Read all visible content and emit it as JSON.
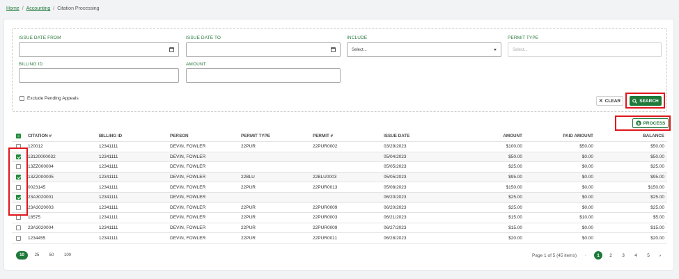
{
  "breadcrumb": {
    "home": "Home",
    "accounting": "Accounting",
    "current": "Citation Processing",
    "sep": "/"
  },
  "filters": {
    "issue_date_from": {
      "label": "ISSUE DATE FROM",
      "value": ""
    },
    "issue_date_to": {
      "label": "ISSUE DATE TO",
      "value": ""
    },
    "include": {
      "label": "INCLUDE",
      "value": "Select..."
    },
    "permit_type": {
      "label": "PERMIT TYPE",
      "placeholder": "Select..."
    },
    "billing_id": {
      "label": "BILLING ID",
      "value": ""
    },
    "amount": {
      "label": "AMOUNT",
      "value": ""
    },
    "exclude_pending_appeals": {
      "label": "Exclude Pending Appeals",
      "checked": false
    }
  },
  "buttons": {
    "clear": "CLEAR",
    "search": "SEARCH",
    "process": "PROCESS"
  },
  "table": {
    "columns": [
      "CITATION #",
      "BILLING ID",
      "PERSON",
      "PERMIT TYPE",
      "PERMIT #",
      "ISSUE DATE",
      "AMOUNT",
      "PAID AMOUNT",
      "BALANCE"
    ],
    "rows": [
      {
        "checked": false,
        "citation": "120012",
        "billing": "12341111",
        "person": "DEVIN, FOWLER",
        "ptype": "22PUR",
        "permit": "22PUR0002",
        "date": "03/29/2023",
        "amount": "$100.00",
        "paid": "$50.00",
        "balance": "$50.00"
      },
      {
        "checked": true,
        "citation": "13120000032",
        "billing": "12341111",
        "person": "DEVIN, FOWLER",
        "ptype": "",
        "permit": "",
        "date": "05/04/2023",
        "amount": "$50.00",
        "paid": "$0.00",
        "balance": "$50.00"
      },
      {
        "checked": false,
        "citation": "13ZZ000004",
        "billing": "12341111",
        "person": "DEVIN, FOWLER",
        "ptype": "",
        "permit": "",
        "date": "05/05/2023",
        "amount": "$25.00",
        "paid": "$0.00",
        "balance": "$25.00"
      },
      {
        "checked": true,
        "citation": "13ZZ000005",
        "billing": "12341111",
        "person": "DEVIN, FOWLER",
        "ptype": "22BLU",
        "permit": "22BLU0003",
        "date": "05/05/2023",
        "amount": "$95.00",
        "paid": "$0.00",
        "balance": "$95.00"
      },
      {
        "checked": false,
        "citation": "0023145",
        "billing": "12341111",
        "person": "DEVIN, FOWLER",
        "ptype": "22PUR",
        "permit": "22PUR0013",
        "date": "05/08/2023",
        "amount": "$150.00",
        "paid": "$0.00",
        "balance": "$150.00"
      },
      {
        "checked": true,
        "citation": "23A3020001",
        "billing": "12341111",
        "person": "DEVIN, FOWLER",
        "ptype": "",
        "permit": "",
        "date": "06/20/2023",
        "amount": "$25.00",
        "paid": "$0.00",
        "balance": "$25.00"
      },
      {
        "checked": false,
        "citation": "23A3020003",
        "billing": "12341111",
        "person": "DEVIN, FOWLER",
        "ptype": "22PUR",
        "permit": "22PUR0009",
        "date": "06/20/2023",
        "amount": "$25.00",
        "paid": "$0.00",
        "balance": "$25.00"
      },
      {
        "checked": false,
        "citation": "18575",
        "billing": "12341111",
        "person": "DEVIN, FOWLER",
        "ptype": "22PUR",
        "permit": "22PUR0003",
        "date": "06/21/2023",
        "amount": "$15.00",
        "paid": "$10.00",
        "balance": "$5.00"
      },
      {
        "checked": false,
        "citation": "23A3020004",
        "billing": "12341111",
        "person": "DEVIN, FOWLER",
        "ptype": "22PUR",
        "permit": "22PUR0009",
        "date": "06/27/2023",
        "amount": "$15.00",
        "paid": "$0.00",
        "balance": "$15.00"
      },
      {
        "checked": false,
        "citation": "1234455",
        "billing": "12341111",
        "person": "DEVIN, FOWLER",
        "ptype": "22PUR",
        "permit": "22PUR0011",
        "date": "06/28/2023",
        "amount": "$20.00",
        "paid": "$0.00",
        "balance": "$20.00"
      }
    ]
  },
  "pagination": {
    "sizes": [
      "10",
      "25",
      "50",
      "100"
    ],
    "selected_size": "10",
    "info": "Page 1 of 5 (45 items)",
    "prev": "‹",
    "pages": [
      "1",
      "2",
      "3",
      "4",
      "5"
    ],
    "current": "1",
    "next": "›"
  },
  "icons": {
    "clear": "✕",
    "search": "search-icon",
    "process": "dollar-icon"
  },
  "colors": {
    "brand": "#1f7a3a",
    "highlight": "#e0161b"
  }
}
